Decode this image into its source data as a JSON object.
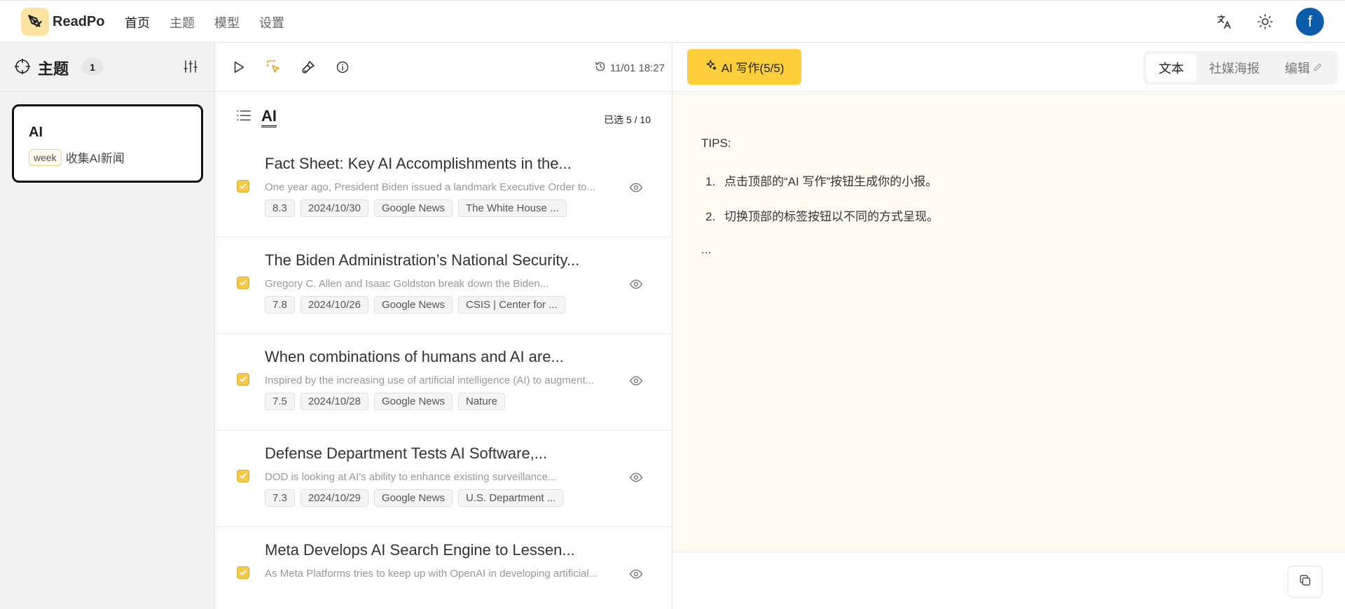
{
  "app": {
    "name": "ReadPo"
  },
  "nav": {
    "items": [
      "首页",
      "主题",
      "模型",
      "设置"
    ],
    "active": 0
  },
  "user": {
    "avatar_letter": "f",
    "avatar_color": "#0b5cab"
  },
  "topics_panel": {
    "title": "主题",
    "count": "1",
    "topic": {
      "name": "AI",
      "frequency": "week",
      "description": "收集AI新闻"
    }
  },
  "toolbar": {
    "timestamp": "11/01 18:27"
  },
  "list": {
    "title": "AI",
    "selected": "已选 5 / 10",
    "articles": [
      {
        "title": "Fact Sheet: Key AI Accomplishments in the...",
        "summary": "One year ago, President Biden issued a landmark Executive Order to...",
        "score": "8.3",
        "date": "2024/10/30",
        "source": "Google News",
        "publisher": "The White House ...",
        "checked": true
      },
      {
        "title": "The Biden Administration’s National Security...",
        "summary": "Gregory C. Allen and Isaac Goldston break down the Biden...",
        "score": "7.8",
        "date": "2024/10/26",
        "source": "Google News",
        "publisher": "CSIS | Center for ...",
        "checked": true
      },
      {
        "title": "When combinations of humans and AI are...",
        "summary": "Inspired by the increasing use of artificial intelligence (AI) to augment...",
        "score": "7.5",
        "date": "2024/10/28",
        "source": "Google News",
        "publisher": "Nature",
        "checked": true
      },
      {
        "title": "Defense Department Tests AI Software,...",
        "summary": "DOD is looking at AI's ability to enhance existing surveillance...",
        "score": "7.3",
        "date": "2024/10/29",
        "source": "Google News",
        "publisher": "U.S. Department ...",
        "checked": true
      },
      {
        "title": "Meta Develops AI Search Engine to Lessen...",
        "summary": "As Meta Platforms tries to keep up with OpenAI in developing artificial...",
        "checked": true
      }
    ]
  },
  "writer": {
    "ai_button": "AI 写作(5/5)",
    "tabs": [
      "文本",
      "社媒海报",
      "编辑"
    ],
    "active_tab": 0,
    "tips_label": "TIPS:",
    "tips": [
      {
        "num": "1.",
        "text": "点击顶部的“AI 写作”按钮生成你的小报。"
      },
      {
        "num": "2.",
        "text": "切换顶部的标签按钮以不同的方式呈现。"
      }
    ],
    "ellipsis": "..."
  },
  "colors": {
    "accent": "#fccf3a",
    "checkbox": "#f7c948",
    "content_bg": "#fffbf3"
  }
}
